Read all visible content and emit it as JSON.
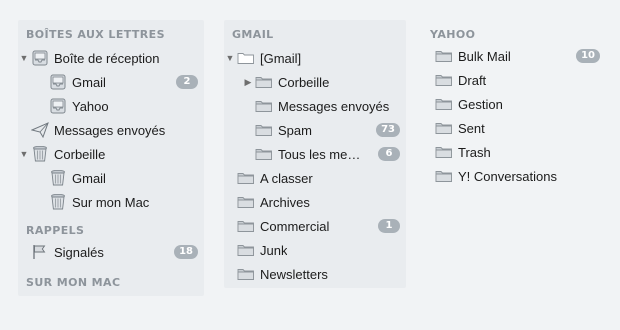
{
  "mailboxes": {
    "title": "BOÎTES AUX LETTRES",
    "items": [
      {
        "label": "Boîte de réception",
        "badge": ""
      },
      {
        "label": "Gmail",
        "badge": "2"
      },
      {
        "label": "Yahoo",
        "badge": ""
      },
      {
        "label": "Messages envoyés",
        "badge": ""
      },
      {
        "label": "Corbeille",
        "badge": ""
      },
      {
        "label": "Gmail",
        "badge": ""
      },
      {
        "label": "Sur mon Mac",
        "badge": ""
      }
    ]
  },
  "reminders": {
    "title": "RAPPELS",
    "items": [
      {
        "label": "Signalés",
        "badge": "18"
      }
    ]
  },
  "on_my_mac": {
    "title": "SUR MON MAC"
  },
  "gmail": {
    "title": "GMAIL",
    "items": [
      {
        "label": "[Gmail]",
        "badge": ""
      },
      {
        "label": "Corbeille",
        "badge": ""
      },
      {
        "label": "Messages envoyés",
        "badge": ""
      },
      {
        "label": "Spam",
        "badge": "73"
      },
      {
        "label": "Tous les me…",
        "badge": "6"
      },
      {
        "label": "A classer",
        "badge": ""
      },
      {
        "label": "Archives",
        "badge": ""
      },
      {
        "label": "Commercial",
        "badge": "1"
      },
      {
        "label": "Junk",
        "badge": ""
      },
      {
        "label": "Newsletters",
        "badge": ""
      }
    ]
  },
  "yahoo": {
    "title": "YAHOO",
    "items": [
      {
        "label": "Bulk Mail",
        "badge": "10"
      },
      {
        "label": "Draft",
        "badge": ""
      },
      {
        "label": "Gestion",
        "badge": ""
      },
      {
        "label": "Sent",
        "badge": ""
      },
      {
        "label": "Trash",
        "badge": ""
      },
      {
        "label": "Y! Conversations",
        "badge": ""
      }
    ]
  }
}
